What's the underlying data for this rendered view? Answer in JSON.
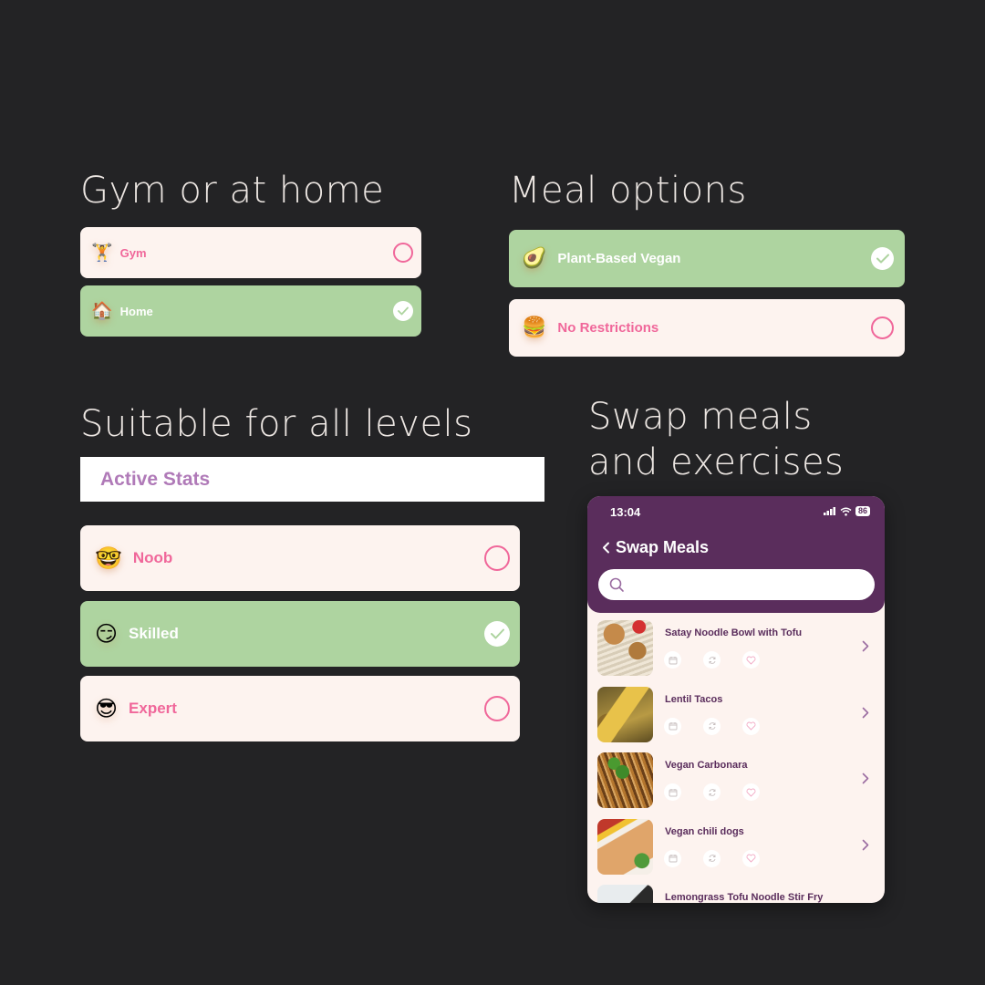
{
  "sections": {
    "location": {
      "heading": "Gym or at home",
      "options": [
        {
          "emoji": "🏋️",
          "icon": "weightlifter-icon",
          "label": "Gym",
          "selected": false
        },
        {
          "emoji": "🏠",
          "icon": "house-icon",
          "label": "Home",
          "selected": true
        }
      ]
    },
    "meals": {
      "heading": "Meal options",
      "options": [
        {
          "emoji": "🥑",
          "icon": "avocado-icon",
          "label": "Plant-Based Vegan",
          "selected": true
        },
        {
          "emoji": "🍔",
          "icon": "burger-icon",
          "label": "No Restrictions",
          "selected": false
        }
      ]
    },
    "levels": {
      "heading": "Suitable for all levels",
      "banner": "Active Stats",
      "options": [
        {
          "emoji": "🤓",
          "icon": "nerd-face-icon",
          "label": "Noob",
          "selected": false
        },
        {
          "emoji": "😏",
          "icon": "smirk-face-icon",
          "label": "Skilled",
          "selected": true
        },
        {
          "emoji": "😎",
          "icon": "sunglasses-face-icon",
          "label": "Expert",
          "selected": false
        }
      ]
    },
    "swap": {
      "heading_line1": "Swap meals",
      "heading_line2": "and exercises"
    }
  },
  "phone": {
    "status": {
      "time": "13:04",
      "battery": "86"
    },
    "title": "Swap Meals",
    "search": {
      "value": "",
      "placeholder": ""
    },
    "meals": [
      {
        "name": "Satay Noodle Bowl with Tofu"
      },
      {
        "name": "Lentil Tacos"
      },
      {
        "name": "Vegan Carbonara"
      },
      {
        "name": "Vegan chili dogs"
      },
      {
        "name": "Lemongrass Tofu Noodle Stir Fry"
      }
    ]
  },
  "colors": {
    "background": "#232325",
    "card": "#fdf3ef",
    "selected": "#aed4a0",
    "accent_pink": "#f0679a",
    "purple": "#5a2d5c",
    "banner_text": "#b07ab8"
  }
}
